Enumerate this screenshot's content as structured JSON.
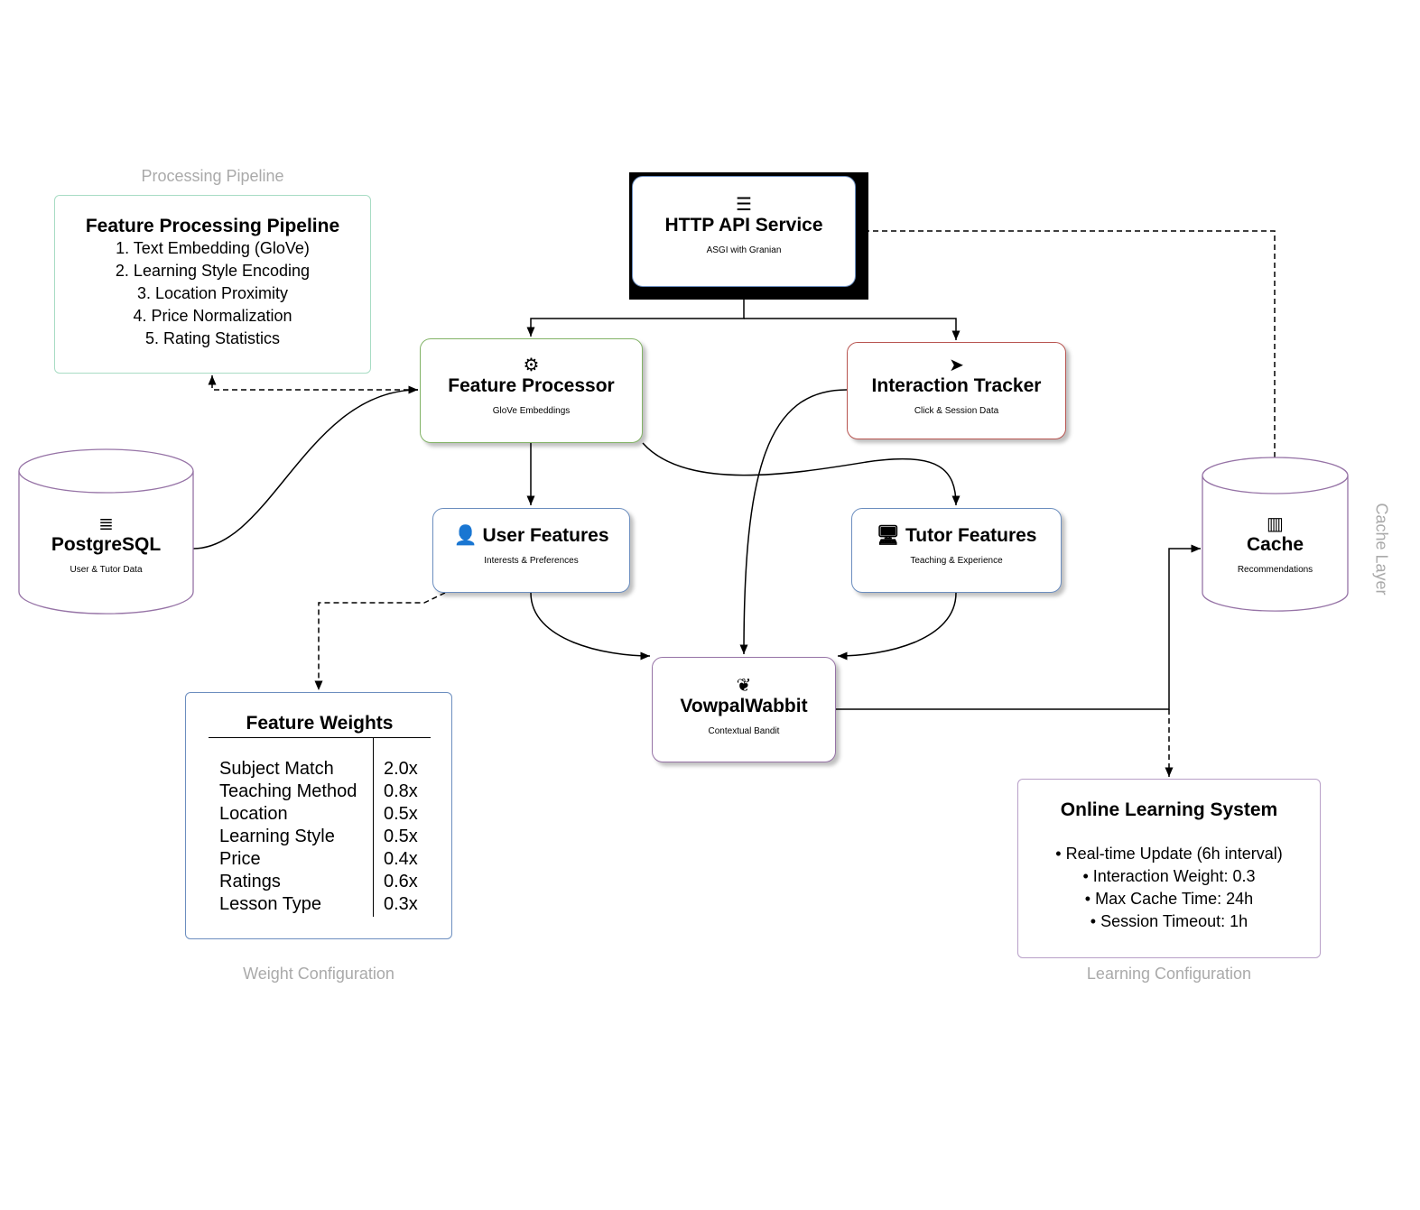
{
  "groups": {
    "processing": "Processing Pipeline",
    "weights": "Weight Configuration",
    "learning": "Learning Configuration",
    "cache": "Cache Layer"
  },
  "pipeline": {
    "title": "Feature Processing Pipeline",
    "steps": [
      "1. Text Embedding (GloVe)",
      "2. Learning Style Encoding",
      "3. Location Proximity",
      "4. Price Normalization",
      "5. Rating Statistics"
    ]
  },
  "nodes": {
    "http": {
      "icon": "server-icon",
      "title": "HTTP API Service",
      "sub": "ASGI with Granian"
    },
    "feature_processor": {
      "icon": "gear-icon",
      "title": "Feature Processor",
      "sub": "GloVe Embeddings"
    },
    "interaction_tracker": {
      "icon": "cursor-icon",
      "title": "Interaction Tracker",
      "sub": "Click & Session Data"
    },
    "user_features": {
      "icon": "user-icon",
      "title": "User Features",
      "sub": "Interests & Preferences"
    },
    "tutor_features": {
      "icon": "teacher-icon",
      "title": "Tutor Features",
      "sub": "Teaching & Experience"
    },
    "postgres": {
      "icon": "database-icon",
      "title": "PostgreSQL",
      "sub": "User & Tutor Data"
    },
    "cache": {
      "icon": "memory-icon",
      "title": "Cache",
      "sub": "Recommendations"
    },
    "vw": {
      "icon": "brain-icon",
      "title": "VowpalWabbit",
      "sub": "Contextual Bandit"
    }
  },
  "weights": {
    "title": "Feature Weights",
    "rows": [
      {
        "name": "Subject Match",
        "value": "2.0x"
      },
      {
        "name": "Teaching Method",
        "value": "0.8x"
      },
      {
        "name": "Location",
        "value": "0.5x"
      },
      {
        "name": "Learning Style",
        "value": "0.5x"
      },
      {
        "name": "Price",
        "value": "0.4x"
      },
      {
        "name": "Ratings",
        "value": "0.6x"
      },
      {
        "name": "Lesson Type",
        "value": "0.3x"
      }
    ]
  },
  "learning": {
    "title": "Online Learning System",
    "items": [
      "• Real-time Update (6h interval)",
      "• Interaction Weight: 0.3",
      "• Max Cache Time: 24h",
      "• Session Timeout: 1h"
    ]
  },
  "colors": {
    "green": "#82b366",
    "red": "#b85450",
    "blue": "#6c8ebf",
    "purple": "#9673a6",
    "pipeline": "#a8dcc4"
  }
}
